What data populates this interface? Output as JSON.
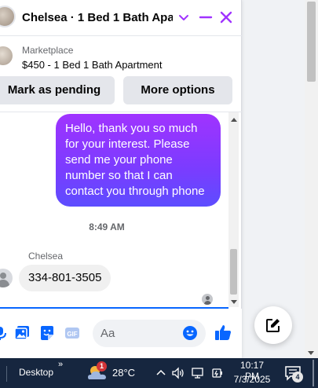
{
  "chat": {
    "title": "Chelsea · 1 Bed 1 Bath Apa...",
    "listing": {
      "kind": "Marketplace",
      "description": "$450 - 1 Bed 1 Bath Apartment"
    },
    "actions": {
      "mark_pending": "Mark as pending",
      "more_options": "More options"
    },
    "messages": {
      "outgoing_text": "Hello, thank you so much for your interest. Please send me your phone number so that I can contact you through phone",
      "timestamp": "8:49 AM",
      "sender_name": "Chelsea",
      "incoming_text": "334-801-3505"
    },
    "composer": {
      "placeholder": "Aa"
    },
    "colors": {
      "accent": "#0866ff",
      "bubble_gradient_top": "#a033ff",
      "bubble_gradient_bottom": "#5d4dff",
      "header_icons": "#a033ff"
    },
    "icons": [
      "chevron-down-icon",
      "minimize-icon",
      "close-icon",
      "microphone-icon",
      "photo-icon",
      "sticker-icon",
      "gif-icon",
      "emoji-icon",
      "thumbs-up-icon",
      "compose-icon"
    ]
  },
  "taskbar": {
    "desktop_label": "Desktop",
    "overflow_chevron": "»",
    "weather_badge": "1",
    "temperature": "28°C",
    "time": "10:17 PM",
    "date": "7/3/2025",
    "notification_count": "4"
  }
}
